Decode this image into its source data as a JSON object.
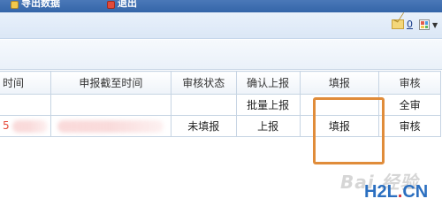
{
  "toolbar": {
    "item1_label": "导出数据",
    "item2_label": "退出"
  },
  "status": {
    "mail_count": "0"
  },
  "table": {
    "headers": [
      "时间",
      "申报截至时间",
      "审核状态",
      "确认上报",
      "填报",
      "审核"
    ],
    "rows": [
      {
        "time": "",
        "deadline": "",
        "status": "",
        "confirm": "批量上报",
        "fill": "",
        "review": "全审"
      },
      {
        "time": "5",
        "deadline": "",
        "status": "未填报",
        "confirm": "上报",
        "fill": "填报",
        "review": "审核"
      }
    ]
  },
  "colors": {
    "highlight": "#e08c3a",
    "link": "#2350a6",
    "header_band": "#3465a8"
  },
  "watermark": {
    "baidu": "Bai 经验",
    "h2l": "H2L",
    "dot": ".",
    "cn": "CN"
  }
}
